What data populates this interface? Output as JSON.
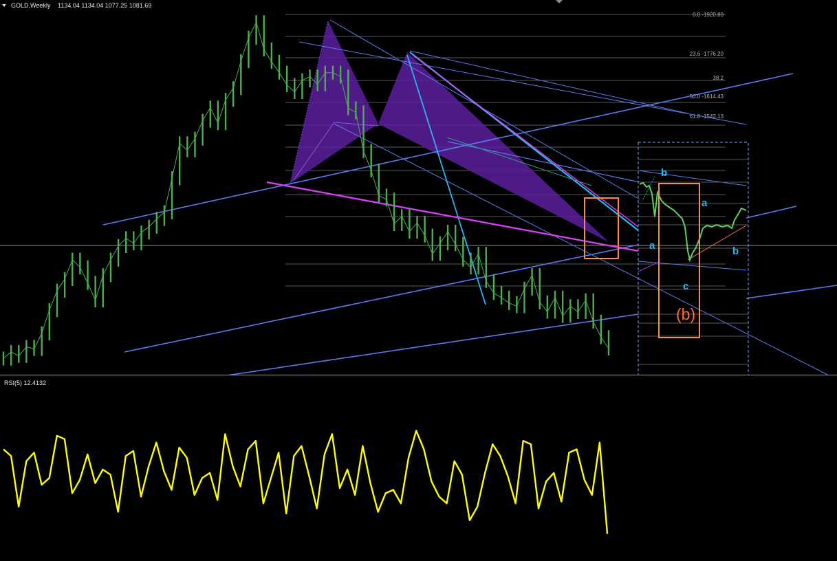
{
  "header": {
    "symbol": "GOLD,Weekly",
    "ohlc": "1134.04 1134.04 1077.25 1081.69",
    "indicator": "RSI(5) 12.4132"
  },
  "fib_levels": [
    {
      "label": "0.0 -1920.80"
    },
    {
      "label": "23.6 -1776.20"
    },
    {
      "label": "38.2"
    },
    {
      "label": "50.0 -1614.43"
    },
    {
      "label": "61.8 -1542.13"
    }
  ],
  "wave_labels": [
    {
      "text": "b",
      "color": "#29b6f6"
    },
    {
      "text": "a",
      "color": "#29b6f6"
    },
    {
      "text": "a",
      "color": "#29b6f6"
    },
    {
      "text": "b",
      "color": "#29b6f6"
    },
    {
      "text": "c",
      "color": "#29b6f6"
    },
    {
      "text": "(b)",
      "color": "#ff6d3a"
    }
  ],
  "colors": {
    "price": "#4caf50",
    "pattern_fill": "#5b1f9e",
    "trend_blue": "#5b7cf0",
    "trend_cyan": "#29b6f6",
    "trend_magenta": "#e040fb",
    "box_orange": "#ff8a4c",
    "rsi": "#ffff00"
  },
  "chart_data": [
    {
      "type": "line",
      "title": "GOLD,Weekly",
      "series": [
        {
          "name": "GOLD,Weekly",
          "values": [
            1055,
            1072,
            1062,
            1085,
            1080,
            1120,
            1180,
            1230,
            1260,
            1310,
            1290,
            1250,
            1205,
            1270,
            1310,
            1345,
            1365,
            1352,
            1380,
            1395,
            1415,
            1432,
            1520,
            1610,
            1592,
            1622,
            1668,
            1702,
            1662,
            1722,
            1752,
            1822,
            1882,
            1922,
            1852,
            1820,
            1792,
            1760,
            1742,
            1772,
            1782,
            1762,
            1792,
            1792,
            1782,
            1700,
            1690,
            1590,
            1540,
            1475,
            1465,
            1402,
            1422,
            1382,
            1405,
            1372,
            1325,
            1352,
            1382,
            1350,
            1310,
            1290,
            1325,
            1255,
            1224,
            1212,
            1198,
            1190,
            1235,
            1270,
            1200,
            1176,
            1212,
            1165,
            1190,
            1175,
            1205,
            1150,
            1110,
            1081
          ]
        }
      ]
    },
    {
      "type": "line",
      "title": "RSI(5) 12.4132",
      "series": [
        {
          "name": "RSI(5)",
          "values": [
            62,
            58,
            28,
            55,
            60,
            41,
            45,
            70,
            68,
            36,
            44,
            59,
            42,
            50,
            47,
            25,
            58,
            61,
            34,
            52,
            66,
            49,
            38,
            63,
            57,
            35,
            45,
            48,
            32,
            71,
            52,
            40,
            62,
            67,
            30,
            45,
            60,
            24,
            58,
            64,
            46,
            27,
            59,
            71,
            39,
            50,
            35,
            64,
            42,
            25,
            36,
            38,
            30,
            57,
            73,
            62,
            43,
            34,
            30,
            55,
            47,
            20,
            28,
            48,
            65,
            58,
            46,
            30,
            67,
            65,
            27,
            43,
            48,
            31,
            60,
            62,
            44,
            35,
            66,
            12
          ]
        }
      ]
    }
  ]
}
